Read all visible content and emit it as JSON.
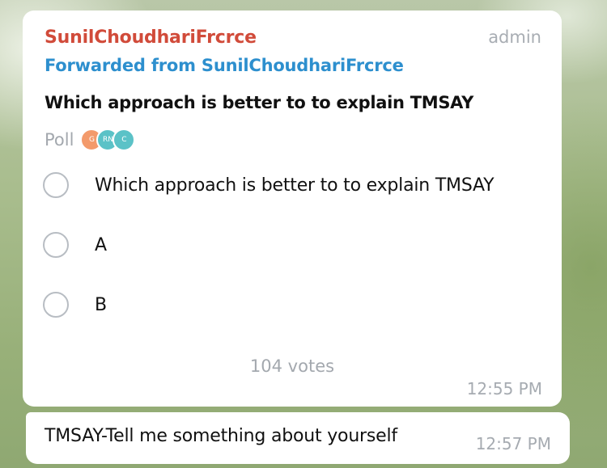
{
  "poll_message": {
    "sender": "SunilChoudhariFrcrce",
    "role": "admin",
    "forwarded_from": "Forwarded from SunilChoudhariFrcrce",
    "question": "Which approach is better to to explain TMSAY",
    "poll_label": "Poll",
    "voter_avatars": [
      {
        "initials": "G",
        "color": "#f39a6b"
      },
      {
        "initials": "RN",
        "color": "#5bc2c7"
      },
      {
        "initials": "C",
        "color": "#5bc2c7"
      }
    ],
    "options": [
      {
        "label": "Which approach is better to to explain TMSAY"
      },
      {
        "label": "A"
      },
      {
        "label": "B"
      }
    ],
    "votes": "104 votes",
    "time": "12:55 PM"
  },
  "text_message": {
    "text": "TMSAY-Tell me something about yourself",
    "time": "12:57 PM"
  }
}
